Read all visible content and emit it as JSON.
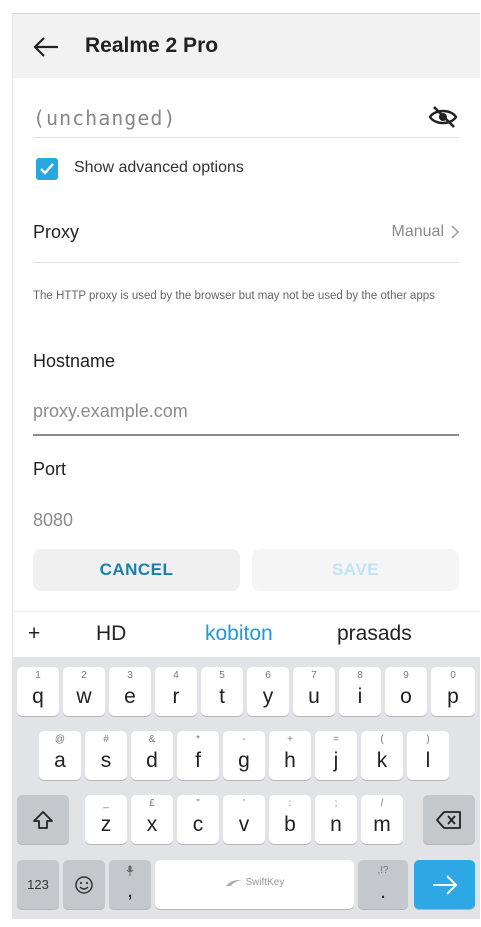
{
  "header": {
    "title": "Realme 2 Pro"
  },
  "password": {
    "value": "(unchanged)"
  },
  "advanced": {
    "label": "Show advanced options",
    "checked": true
  },
  "proxy": {
    "label": "Proxy",
    "value": "Manual",
    "hint": "The HTTP proxy is used by the browser but may not be used by the other apps"
  },
  "hostname": {
    "label": "Hostname",
    "placeholder": "proxy.example.com"
  },
  "port": {
    "label": "Port",
    "placeholder": "8080"
  },
  "buttons": {
    "cancel": "CANCEL",
    "save": "SAVE"
  },
  "suggestions": {
    "plus": "+",
    "items": [
      "HD",
      "kobiton",
      "prasads"
    ]
  },
  "keyboard": {
    "row1": [
      {
        "num": "1",
        "ch": "q"
      },
      {
        "num": "2",
        "ch": "w"
      },
      {
        "num": "3",
        "ch": "e"
      },
      {
        "num": "4",
        "ch": "r"
      },
      {
        "num": "5",
        "ch": "t"
      },
      {
        "num": "6",
        "ch": "y"
      },
      {
        "num": "7",
        "ch": "u"
      },
      {
        "num": "8",
        "ch": "i"
      },
      {
        "num": "9",
        "ch": "o"
      },
      {
        "num": "0",
        "ch": "p"
      }
    ],
    "row2": [
      {
        "num": "@",
        "ch": "a"
      },
      {
        "num": "#",
        "ch": "s"
      },
      {
        "num": "&",
        "ch": "d"
      },
      {
        "num": "*",
        "ch": "f"
      },
      {
        "num": "-",
        "ch": "g"
      },
      {
        "num": "+",
        "ch": "h"
      },
      {
        "num": "=",
        "ch": "j"
      },
      {
        "num": "(",
        "ch": "k"
      },
      {
        "num": ")",
        "ch": "l"
      }
    ],
    "row3": [
      {
        "num": "_",
        "ch": "z"
      },
      {
        "num": "£",
        "ch": "x"
      },
      {
        "num": "\"",
        "ch": "c"
      },
      {
        "num": "'",
        "ch": "v"
      },
      {
        "num": ":",
        "ch": "b"
      },
      {
        "num": ";",
        "ch": "n"
      },
      {
        "num": "/",
        "ch": "m"
      }
    ],
    "numbers_key": "123",
    "comma_key": ",",
    "space_label": "SwiftKey",
    "period_key": ".",
    "period_alt": ",!?"
  },
  "colors": {
    "accent": "#29a8e0",
    "cancel_text": "#1b7fa8",
    "enter_key": "#2ea8e4"
  }
}
